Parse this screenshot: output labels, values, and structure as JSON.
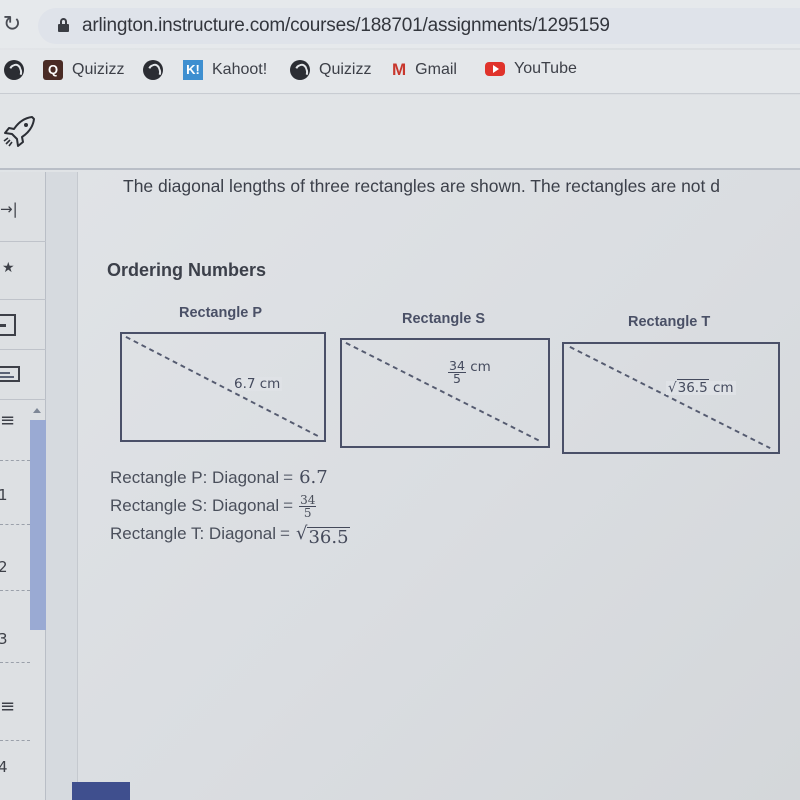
{
  "browser": {
    "url": "arlington.instructure.com/courses/188701/assignments/1295159",
    "reload_icon": "reload-icon",
    "lock_icon": "lock-icon",
    "bookmarks": [
      {
        "icon": "globe-icon",
        "label": ""
      },
      {
        "icon": "quizizz-icon",
        "label": "Quizizz"
      },
      {
        "icon": "globe-icon",
        "label": ""
      },
      {
        "icon": "kahoot-icon",
        "label": "Kahoot!"
      },
      {
        "icon": "globe-icon",
        "label": "Quizizz"
      },
      {
        "icon": "gmail-icon",
        "label": "Gmail"
      },
      {
        "icon": "youtube-icon",
        "label": "YouTube"
      }
    ]
  },
  "app": {
    "logo_icon": "rocket-icon"
  },
  "rail": {
    "items": [
      {
        "icon": "collapse-arrow-icon"
      },
      {
        "icon": "pin-icon"
      },
      {
        "icon": "minus-box-icon"
      },
      {
        "icon": "text-box-icon"
      },
      {
        "icon": "list-icon"
      },
      {
        "number": "1"
      },
      {
        "number": "2"
      },
      {
        "number": "3"
      },
      {
        "icon": "list-icon"
      },
      {
        "number": "4"
      }
    ]
  },
  "question": {
    "intro": "The diagonal lengths of three rectangles are shown. The rectangles are not d",
    "section_title": "Ordering Numbers",
    "rectangles": [
      {
        "name": "Rectangle P",
        "diagonal_label": "6.7 cm"
      },
      {
        "name": "Rectangle S",
        "diagonal_num": "34",
        "diagonal_den": "5",
        "diagonal_unit": "cm"
      },
      {
        "name": "Rectangle T",
        "diagonal_radicand": "36.5",
        "diagonal_unit": "cm"
      }
    ],
    "equations": [
      {
        "label": "Rectangle P: Diagonal",
        "sign": "=",
        "value": "6.7"
      },
      {
        "label": "Rectangle S: Diagonal",
        "sign": "=",
        "num": "34",
        "den": "5"
      },
      {
        "label": "Rectangle T: Diagonal",
        "sign": "=",
        "radicand": "36.5"
      }
    ]
  },
  "colors": {
    "rectangle_stroke": "#4a5068",
    "scroll_thumb": "#9aaad3",
    "button": "#3f4f8e"
  }
}
